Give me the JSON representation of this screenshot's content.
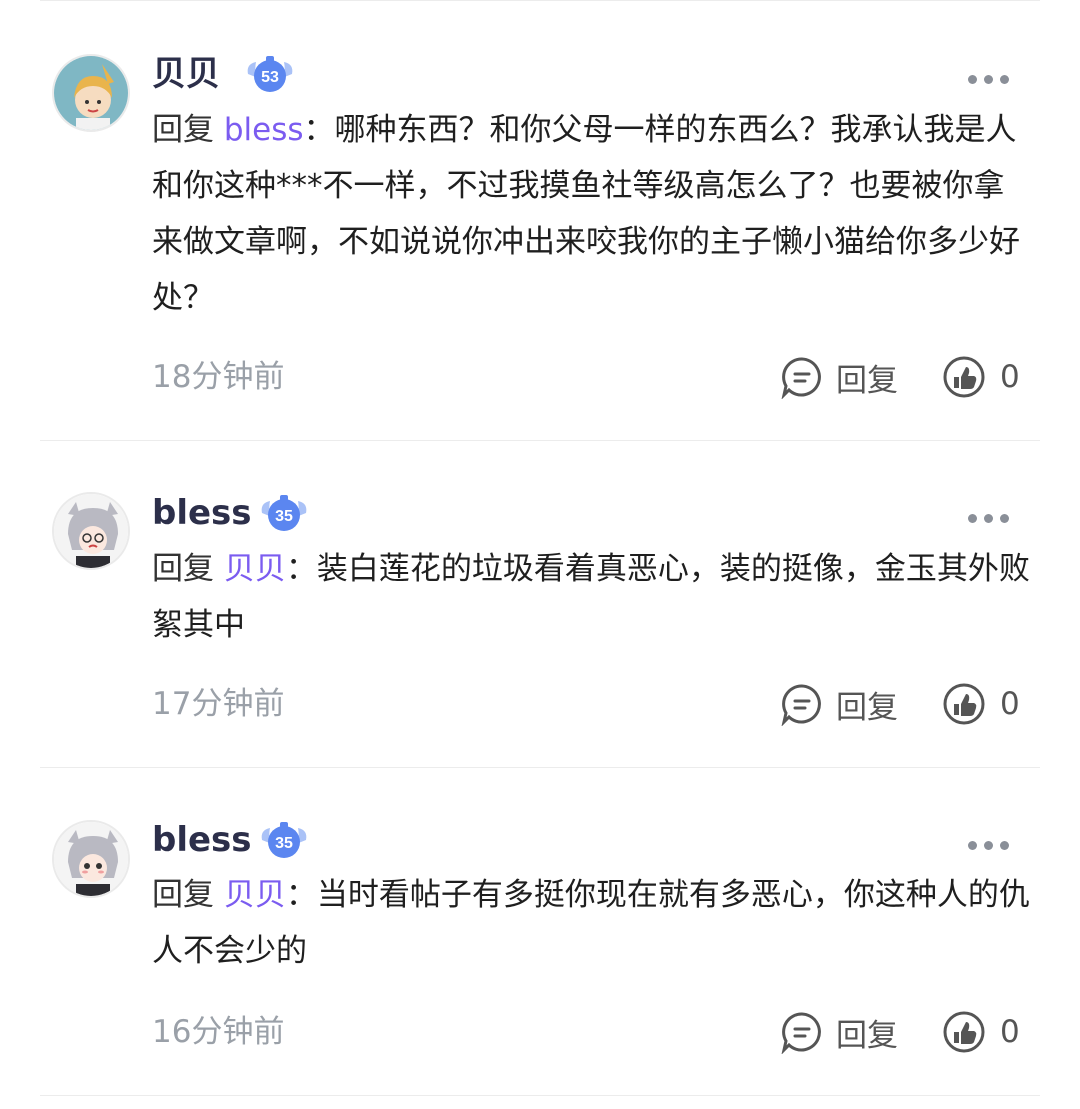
{
  "comments": [
    {
      "username": "贝贝",
      "level": "53",
      "reply_prefix": "回复 ",
      "reply_target": "bless",
      "colon": "：",
      "text": "哪种东西？和你父母一样的东西么？我承认我是人和你这种***不一样，不过我摸鱼社等级高怎么了？也要被你拿来做文章啊，不如说说你冲出来咬我你的主子懒小猫给你多少好处？",
      "time": "18分钟前",
      "reply_label": "回复",
      "likes": "0"
    },
    {
      "username": "bless",
      "level": "35",
      "reply_prefix": "回复 ",
      "reply_target": "贝贝",
      "colon": "：",
      "text": "装白莲花的垃圾看着真恶心，装的挺像，金玉其外败絮其中",
      "time": "17分钟前",
      "reply_label": "回复",
      "likes": "0"
    },
    {
      "username": "bless",
      "level": "35",
      "reply_prefix": "回复 ",
      "reply_target": "贝贝",
      "colon": "：",
      "text": "当时看帖子有多挺你现在就有多恶心，你这种人的仇人不会少的",
      "time": "16分钟前",
      "reply_label": "回复",
      "likes": "0"
    }
  ],
  "colors": {
    "accent": "#7b5cf0",
    "badge": "#5b86f0",
    "time": "#9aa0a8"
  },
  "icons": [
    "more-icon",
    "comment-icon",
    "like-icon",
    "level-badge-icon"
  ]
}
